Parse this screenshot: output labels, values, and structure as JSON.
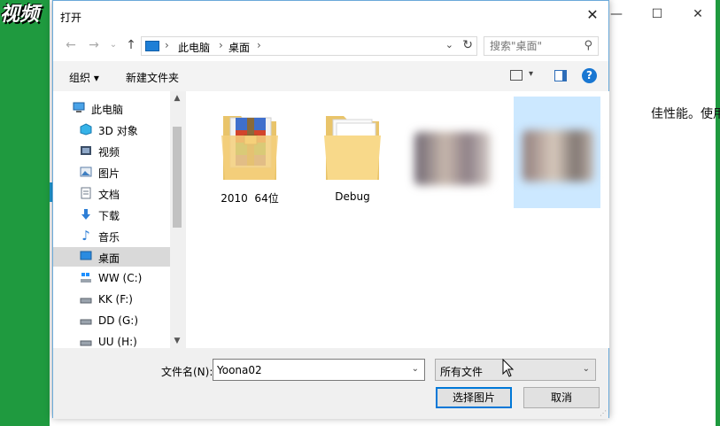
{
  "background": {
    "logo_text": "视频",
    "snippet": "佳性能。使用",
    "window_buttons": [
      "—",
      "☐",
      "✕"
    ]
  },
  "dialog": {
    "title": "打开",
    "close": "✕",
    "nav": {
      "back": "←",
      "forward": "→",
      "recent": "⌄",
      "up": "↑"
    },
    "address": {
      "crumbs": [
        "此电脑",
        "桌面"
      ],
      "refresh": "↻"
    },
    "search": {
      "placeholder": "搜索\"桌面\""
    },
    "toolbar": {
      "organize": "组织 ▾",
      "new_folder": "新建文件夹",
      "help": "?"
    },
    "nav_pane": [
      {
        "label": "此电脑",
        "icon": "computer-icon"
      },
      {
        "label": "3D 对象",
        "icon": "cube-icon"
      },
      {
        "label": "视频",
        "icon": "video-icon"
      },
      {
        "label": "图片",
        "icon": "picture-icon"
      },
      {
        "label": "文档",
        "icon": "document-icon"
      },
      {
        "label": "下载",
        "icon": "download-icon"
      },
      {
        "label": "音乐",
        "icon": "music-icon"
      },
      {
        "label": "桌面",
        "icon": "desktop-icon"
      },
      {
        "label": "WW (C:)",
        "icon": "drive-icon"
      },
      {
        "label": "KK (F:)",
        "icon": "drive-icon"
      },
      {
        "label": "DD (G:)",
        "icon": "drive-icon"
      },
      {
        "label": "UU (H:)",
        "icon": "drive-icon"
      }
    ],
    "files": [
      {
        "label": "2010  64位",
        "icon": "winrar-folder-icon"
      },
      {
        "label": "Debug",
        "icon": "folder-icon"
      },
      {
        "label": "",
        "icon": "blurred-image-thumbnail"
      },
      {
        "label": "",
        "icon": "blurred-image-thumbnail"
      }
    ],
    "bottom": {
      "filename_label": "文件名(N):",
      "filename_value": "Yoona02",
      "filetype_value": "所有文件",
      "open_button": "选择图片",
      "cancel_button": "取消"
    }
  },
  "colors": {
    "accent": "#0078d7",
    "selection": "#cce8ff",
    "background_green": "#1f9a3f"
  }
}
